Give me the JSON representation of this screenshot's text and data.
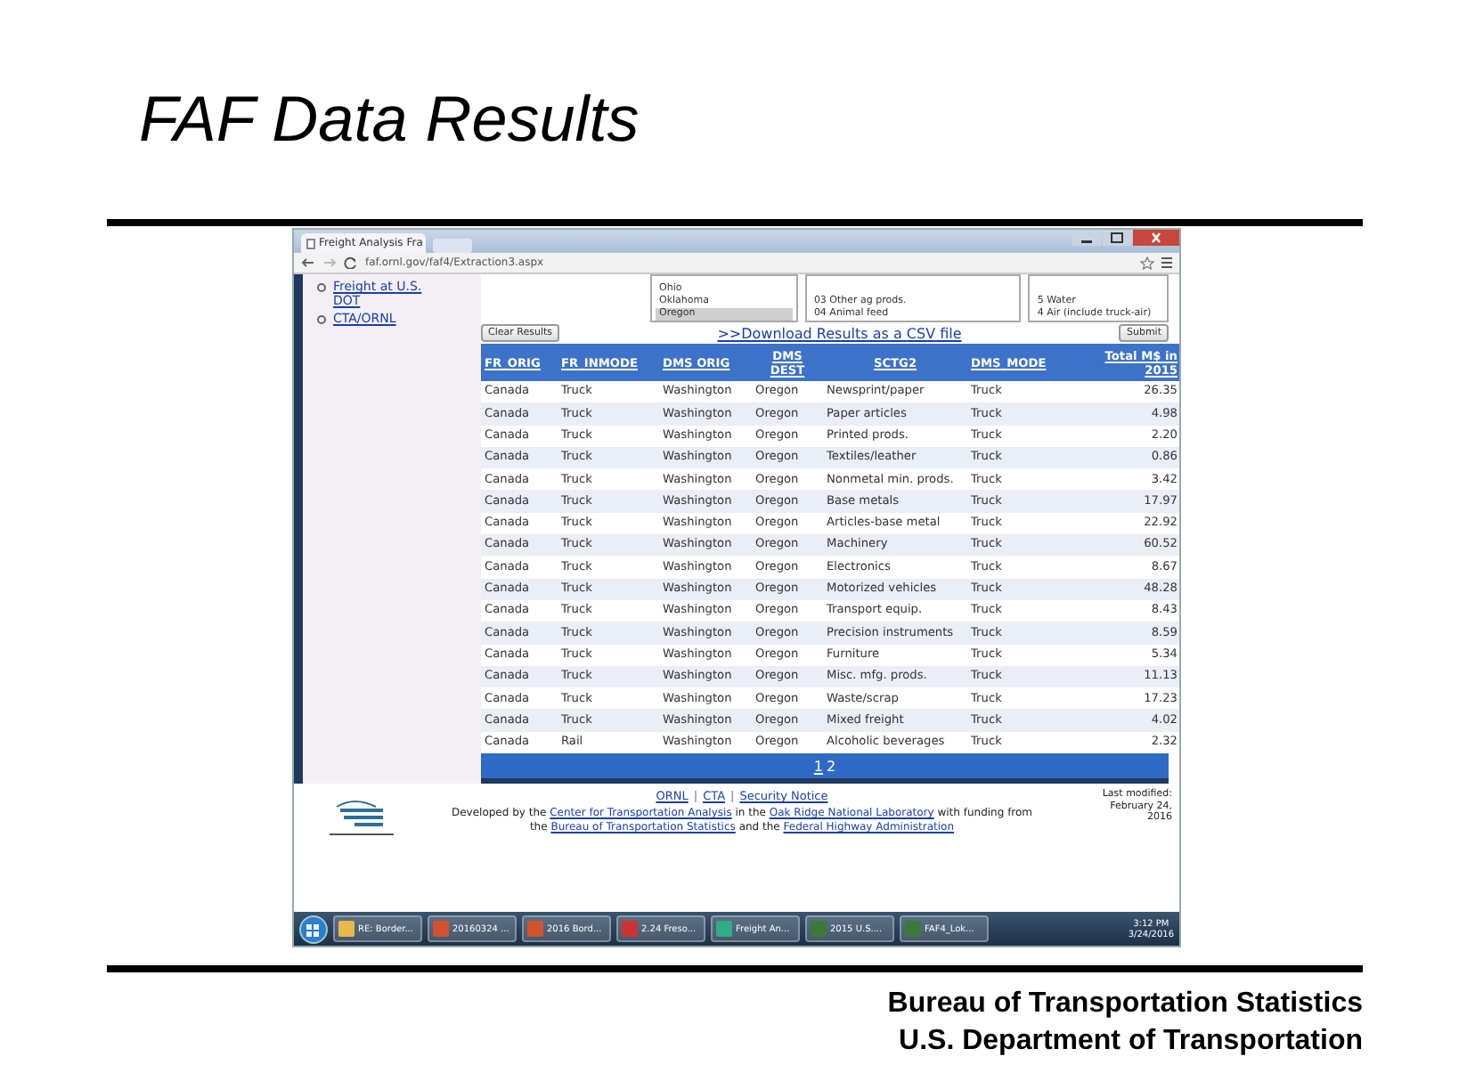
{
  "slide": {
    "title": "FAF Data Results",
    "footer_lines": [
      "Bureau of Transportation Statistics",
      "U.S. Department of Transportation"
    ]
  },
  "browser": {
    "tab_title": "Freight Analysis Fra",
    "url": "faf.ornl.gov/faf4/Extraction3.aspx"
  },
  "sidebar": {
    "links": [
      "Freight at U.S. DOT",
      "CTA/ORNL"
    ]
  },
  "filters": [
    {
      "options": [
        {
          "label": "Ohio",
          "selected": false
        },
        {
          "label": "Oklahoma",
          "selected": false
        },
        {
          "label": "Oregon",
          "selected": true
        }
      ]
    },
    {
      "options": [
        {
          "label": "03 Other ag prods.",
          "selected": false
        },
        {
          "label": "04 Animal feed",
          "selected": false
        }
      ]
    },
    {
      "options": [
        {
          "label": "5 Water",
          "selected": false
        },
        {
          "label": "4 Air (include truck-air)",
          "selected": false
        }
      ]
    }
  ],
  "actions": {
    "clear_button": "Clear Results",
    "download_link": ">>Download Results as a CSV file",
    "submit_button": "Submit"
  },
  "table": {
    "columns": [
      "FR_ORIG",
      "FR_INMODE",
      "DMS ORIG",
      "DMS DEST",
      "SCTG2",
      "DMS_MODE",
      "Total M$ in 2015"
    ],
    "rows": [
      [
        "Canada",
        "Truck",
        "Washington",
        "Oregon",
        "Newsprint/paper",
        "Truck",
        "26.35"
      ],
      [
        "Canada",
        "Truck",
        "Washington",
        "Oregon",
        "Paper articles",
        "Truck",
        "4.98"
      ],
      [
        "Canada",
        "Truck",
        "Washington",
        "Oregon",
        "Printed prods.",
        "Truck",
        "2.20"
      ],
      [
        "Canada",
        "Truck",
        "Washington",
        "Oregon",
        "Textiles/leather",
        "Truck",
        "0.86"
      ],
      [
        "Canada",
        "Truck",
        "Washington",
        "Oregon",
        "Nonmetal min. prods.",
        "Truck",
        "3.42"
      ],
      [
        "Canada",
        "Truck",
        "Washington",
        "Oregon",
        "Base metals",
        "Truck",
        "17.97"
      ],
      [
        "Canada",
        "Truck",
        "Washington",
        "Oregon",
        "Articles-base metal",
        "Truck",
        "22.92"
      ],
      [
        "Canada",
        "Truck",
        "Washington",
        "Oregon",
        "Machinery",
        "Truck",
        "60.52"
      ],
      [
        "Canada",
        "Truck",
        "Washington",
        "Oregon",
        "Electronics",
        "Truck",
        "8.67"
      ],
      [
        "Canada",
        "Truck",
        "Washington",
        "Oregon",
        "Motorized vehicles",
        "Truck",
        "48.28"
      ],
      [
        "Canada",
        "Truck",
        "Washington",
        "Oregon",
        "Transport equip.",
        "Truck",
        "8.43"
      ],
      [
        "Canada",
        "Truck",
        "Washington",
        "Oregon",
        "Precision instruments",
        "Truck",
        "8.59"
      ],
      [
        "Canada",
        "Truck",
        "Washington",
        "Oregon",
        "Furniture",
        "Truck",
        "5.34"
      ],
      [
        "Canada",
        "Truck",
        "Washington",
        "Oregon",
        "Misc. mfg. prods.",
        "Truck",
        "11.13"
      ],
      [
        "Canada",
        "Truck",
        "Washington",
        "Oregon",
        "Waste/scrap",
        "Truck",
        "17.23"
      ],
      [
        "Canada",
        "Truck",
        "Washington",
        "Oregon",
        "Mixed freight",
        "Truck",
        "4.02"
      ],
      [
        "Canada",
        "Rail",
        "Washington",
        "Oregon",
        "Alcoholic beverages",
        "Truck",
        "2.32"
      ]
    ]
  },
  "pager": [
    {
      "label": "1",
      "selected": false
    },
    {
      "label": "2",
      "selected": true
    }
  ],
  "site_footer": {
    "links": [
      "ORNL",
      "CTA",
      "Security Notice"
    ],
    "separators": [
      "|",
      "|"
    ],
    "credits": [
      {
        "text": "Developed by the ",
        "kind": "text"
      },
      {
        "text": "Center for Transportation Analysis",
        "kind": "link"
      },
      {
        "text": " in the ",
        "kind": "text"
      },
      {
        "text": "Oak Ridge National Laboratory",
        "kind": "link"
      },
      {
        "text": " with funding from the ",
        "kind": "text"
      },
      {
        "text": "Bureau of Transportation Statistics",
        "kind": "link"
      },
      {
        "text": " and the ",
        "kind": "text"
      },
      {
        "text": "Federal Highway Administration",
        "kind": "link"
      }
    ],
    "last_modified": "Last modified: February 24, 2016"
  },
  "taskbar": {
    "items": [
      "RE: Border...",
      "20160324 ...",
      "2016 Bord...",
      "2.24 Freso...",
      "Freight An...",
      "2015 U.S....",
      "FAF4_Lok..."
    ],
    "time": "3:12 PM",
    "date": "3/24/2016"
  }
}
